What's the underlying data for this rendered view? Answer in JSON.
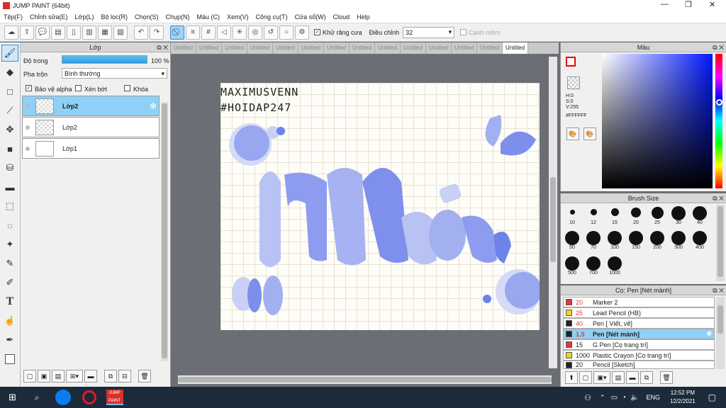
{
  "window": {
    "title": "JUMP PAINT (64bit)"
  },
  "menu": [
    "Tệp(F)",
    "Chỉnh sửa(E)",
    "Lớp(L)",
    "Bộ lọc(R)",
    "Chọn(S)",
    "Chụp(N)",
    "Màu (C)",
    "Xem(V)",
    "Công cụ(T)",
    "Cửa sổ(W)",
    "Cloud",
    "Help"
  ],
  "toolbar": {
    "antialias_label": "Khử răng cưa",
    "adjust_label": "Điều chỉnh",
    "adjust_value": "32",
    "smooth_label": "Cạnh mềm"
  },
  "layers": {
    "title": "Lớp",
    "opacity_label": "Độ trong",
    "opacity_value": "100 %",
    "blend_label": "Pha trộn",
    "blend_value": "Bình thường",
    "protect_alpha": "Bảo vệ alpha",
    "clip": "Xén bớt",
    "lock": "Khóa",
    "items": [
      {
        "name": "Lớp2"
      },
      {
        "name": "Lớp2"
      },
      {
        "name": "Lớp1"
      }
    ]
  },
  "tabs": [
    "Untitled",
    "Untitled",
    "Untitled",
    "Untitled",
    "Untitled",
    "Untitled",
    "Untitled",
    "Untitled",
    "Untitled",
    "Untitled",
    "Untitled",
    "Untitled",
    "Untitled",
    "Untitled"
  ],
  "artwork": {
    "line1": "MAXIMUSVENN",
    "line2": "#HOIDAP247",
    "word": "Nhà"
  },
  "color": {
    "title": "Màu",
    "h": "H:0",
    "s": "S:0",
    "v": "V:255",
    "hex": "#FFFFFF"
  },
  "brush_size": {
    "title": "Brush Size",
    "sizes": [
      "10",
      "12",
      "15",
      "20",
      "25",
      "30",
      "40",
      "50",
      "70",
      "100",
      "150",
      "200",
      "300",
      "400",
      "500",
      "700",
      "1000"
    ]
  },
  "tool_list": {
    "title": "Cọ: Pen [Nét mảnh]",
    "items": [
      {
        "size": "20",
        "name": "Marker 2",
        "color": "#e53935"
      },
      {
        "size": "25",
        "name": "Lead Pencil (HB)",
        "color": "#f2d21b"
      },
      {
        "size": "40",
        "name": "Pen [ Viết, vẽ]",
        "color": "#222222"
      },
      {
        "size": "1.5",
        "name": "Pen [Nét mảnh]",
        "color": "#222222"
      },
      {
        "size": "15",
        "name": "G Pen [Cọ trang trí]",
        "color": "#e53935"
      },
      {
        "size": "1000",
        "name": "Plastic Crayon [Cọ trang trí]",
        "color": "#f2d21b"
      },
      {
        "size": "20",
        "name": "Pencil [Sketch]",
        "color": "#222222"
      }
    ]
  },
  "taskbar": {
    "lang": "ENG",
    "time": "12:52 PM",
    "date": "12/2/2021",
    "app_label": "JUMP PAINT"
  }
}
